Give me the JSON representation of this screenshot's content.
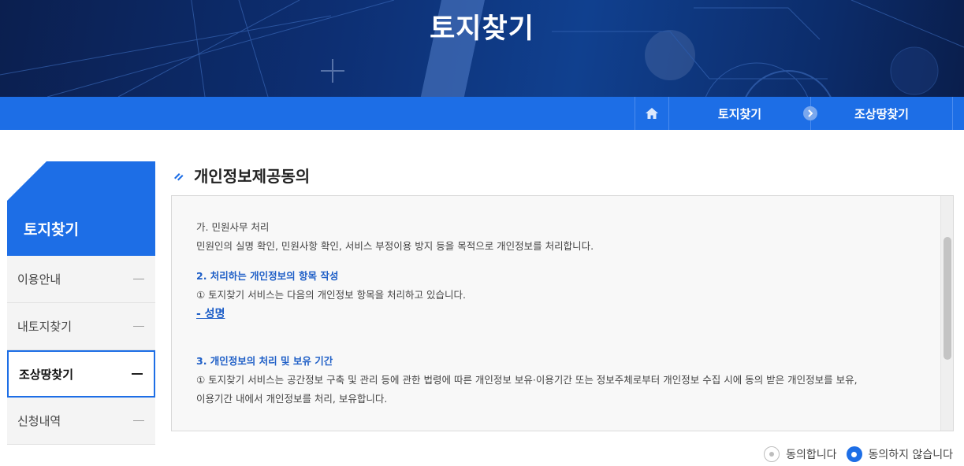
{
  "banner": {
    "title": "토지찾기"
  },
  "breadcrumb": {
    "home_icon": "home-icon",
    "items": [
      "토지찾기",
      "조상땅찾기"
    ],
    "separator_icon": "chevron-right-icon"
  },
  "sidebar": {
    "title": "토지찾기",
    "items": [
      {
        "label": "이용안내",
        "active": false
      },
      {
        "label": "내토지찾기",
        "active": false
      },
      {
        "label": "조상땅찾기",
        "active": true
      },
      {
        "label": "신청내역",
        "active": false
      }
    ]
  },
  "section": {
    "title": "개인정보제공동의",
    "terms": {
      "p1_head": "가. 민원사무 처리",
      "p1_body": "민원인의 실명 확인, 민원사항 확인, 서비스 부정이용 방지 등을 목적으로 개인정보를 처리합니다.",
      "p2_head": "2. 처리하는 개인정보의 항목 작성",
      "p2_body": "① 토지찾기 서비스는 다음의 개인정보 항목을 처리하고 있습니다.",
      "p2_link": "- 성명",
      "p3_head": "3. 개인정보의 처리 및 보유 기간",
      "p3_body1": "① 토지찾기 서비스는 공간정보 구축 및 관리 등에 관한 법령에 따른 개인정보 보유·이용기간 또는 정보주체로부터 개인정보 수집 시에 동의 받은 개인정보를 보유,",
      "p3_body2": "이용기간 내에서 개인정보를 처리, 보유합니다."
    }
  },
  "consent": {
    "agree_label": "동의합니다",
    "disagree_label": "동의하지 않습니다",
    "selected": "disagree"
  },
  "colors": {
    "primary": "#1d6ee6",
    "link": "#1f5fc7"
  }
}
